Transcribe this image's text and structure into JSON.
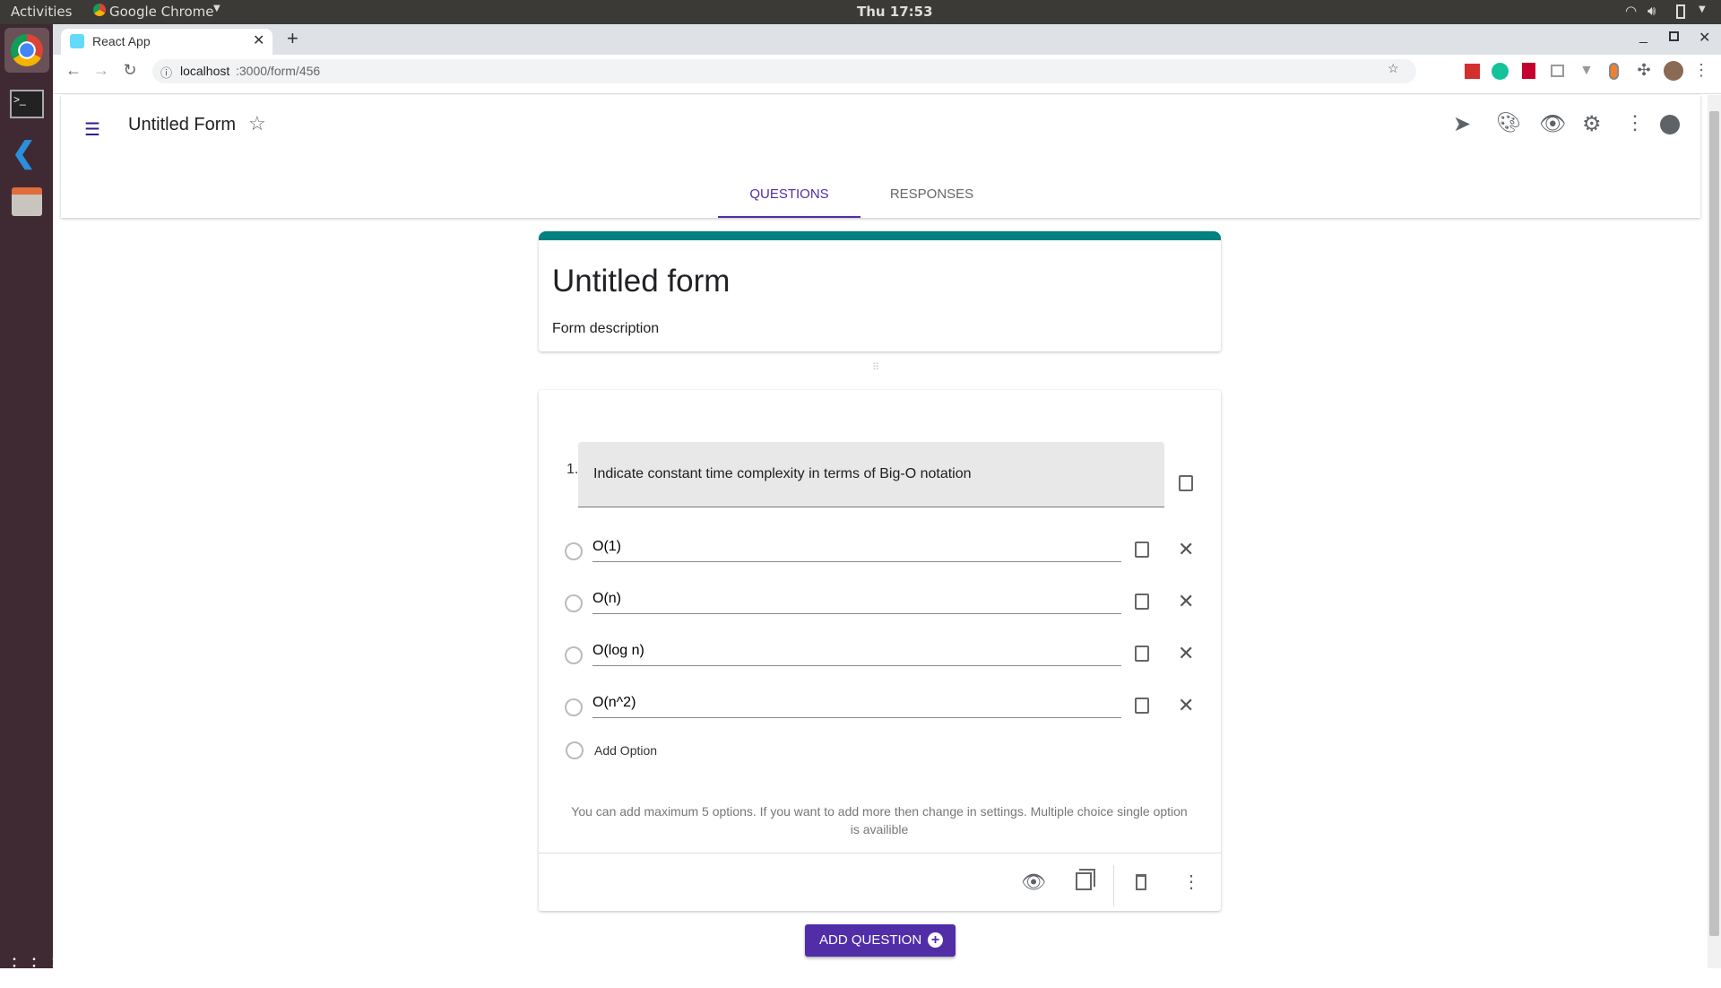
{
  "os": {
    "activities": "Activities",
    "app_menu": "Google Chrome",
    "clock": "Thu 17:53"
  },
  "browser": {
    "tab_title": "React App",
    "url_host": "localhost",
    "url_path": ":3000/form/456"
  },
  "app": {
    "title": "Untitled Form",
    "tabs": [
      {
        "label": "QUESTIONS",
        "active": true
      },
      {
        "label": "RESPONSES",
        "active": false
      }
    ],
    "accent": "#512da8",
    "theme": "#008080"
  },
  "form": {
    "title": "Untitled form",
    "description": "Form description"
  },
  "question": {
    "number": "1.",
    "text": "Indicate constant time complexity in terms of Big-O notation",
    "options": [
      "O(1)",
      "O(n)",
      "O(log n)",
      "O(n^2)"
    ],
    "add_option": "Add Option",
    "helper": "You can add maximum 5 options. If you want to add more then change in settings. Multiple choice single option is availible"
  },
  "add_question": "ADD QUESTION"
}
